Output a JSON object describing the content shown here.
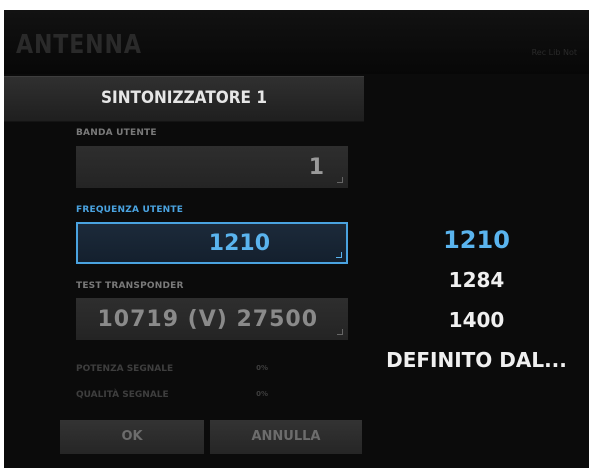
{
  "app": {
    "title": "ANTENNA",
    "top_right": "Rec  Lib  Not"
  },
  "dialog": {
    "title": "SINTONIZZATORE 1",
    "banda_utente": {
      "label": "BANDA UTENTE",
      "value": "1"
    },
    "frequenza_utente": {
      "label": "FREQUENZA UTENTE",
      "value": "1210"
    },
    "test_transponder": {
      "label": "TEST TRANSPONDER",
      "value": "10719 (V) 27500"
    },
    "potenza_segnale": {
      "label": "POTENZA SEGNALE",
      "value": "0%"
    },
    "qualita_segnale": {
      "label": "QUALITÀ SEGNALE",
      "value": "0%"
    },
    "ok_label": "OK",
    "annulla_label": "ANNULLA"
  },
  "frequency_options": {
    "items": [
      "1210",
      "1284",
      "1400",
      "DEFINITO DAL..."
    ],
    "selected": "1210"
  },
  "colors": {
    "accent": "#4aa3e0",
    "background": "#0b0b0b"
  }
}
